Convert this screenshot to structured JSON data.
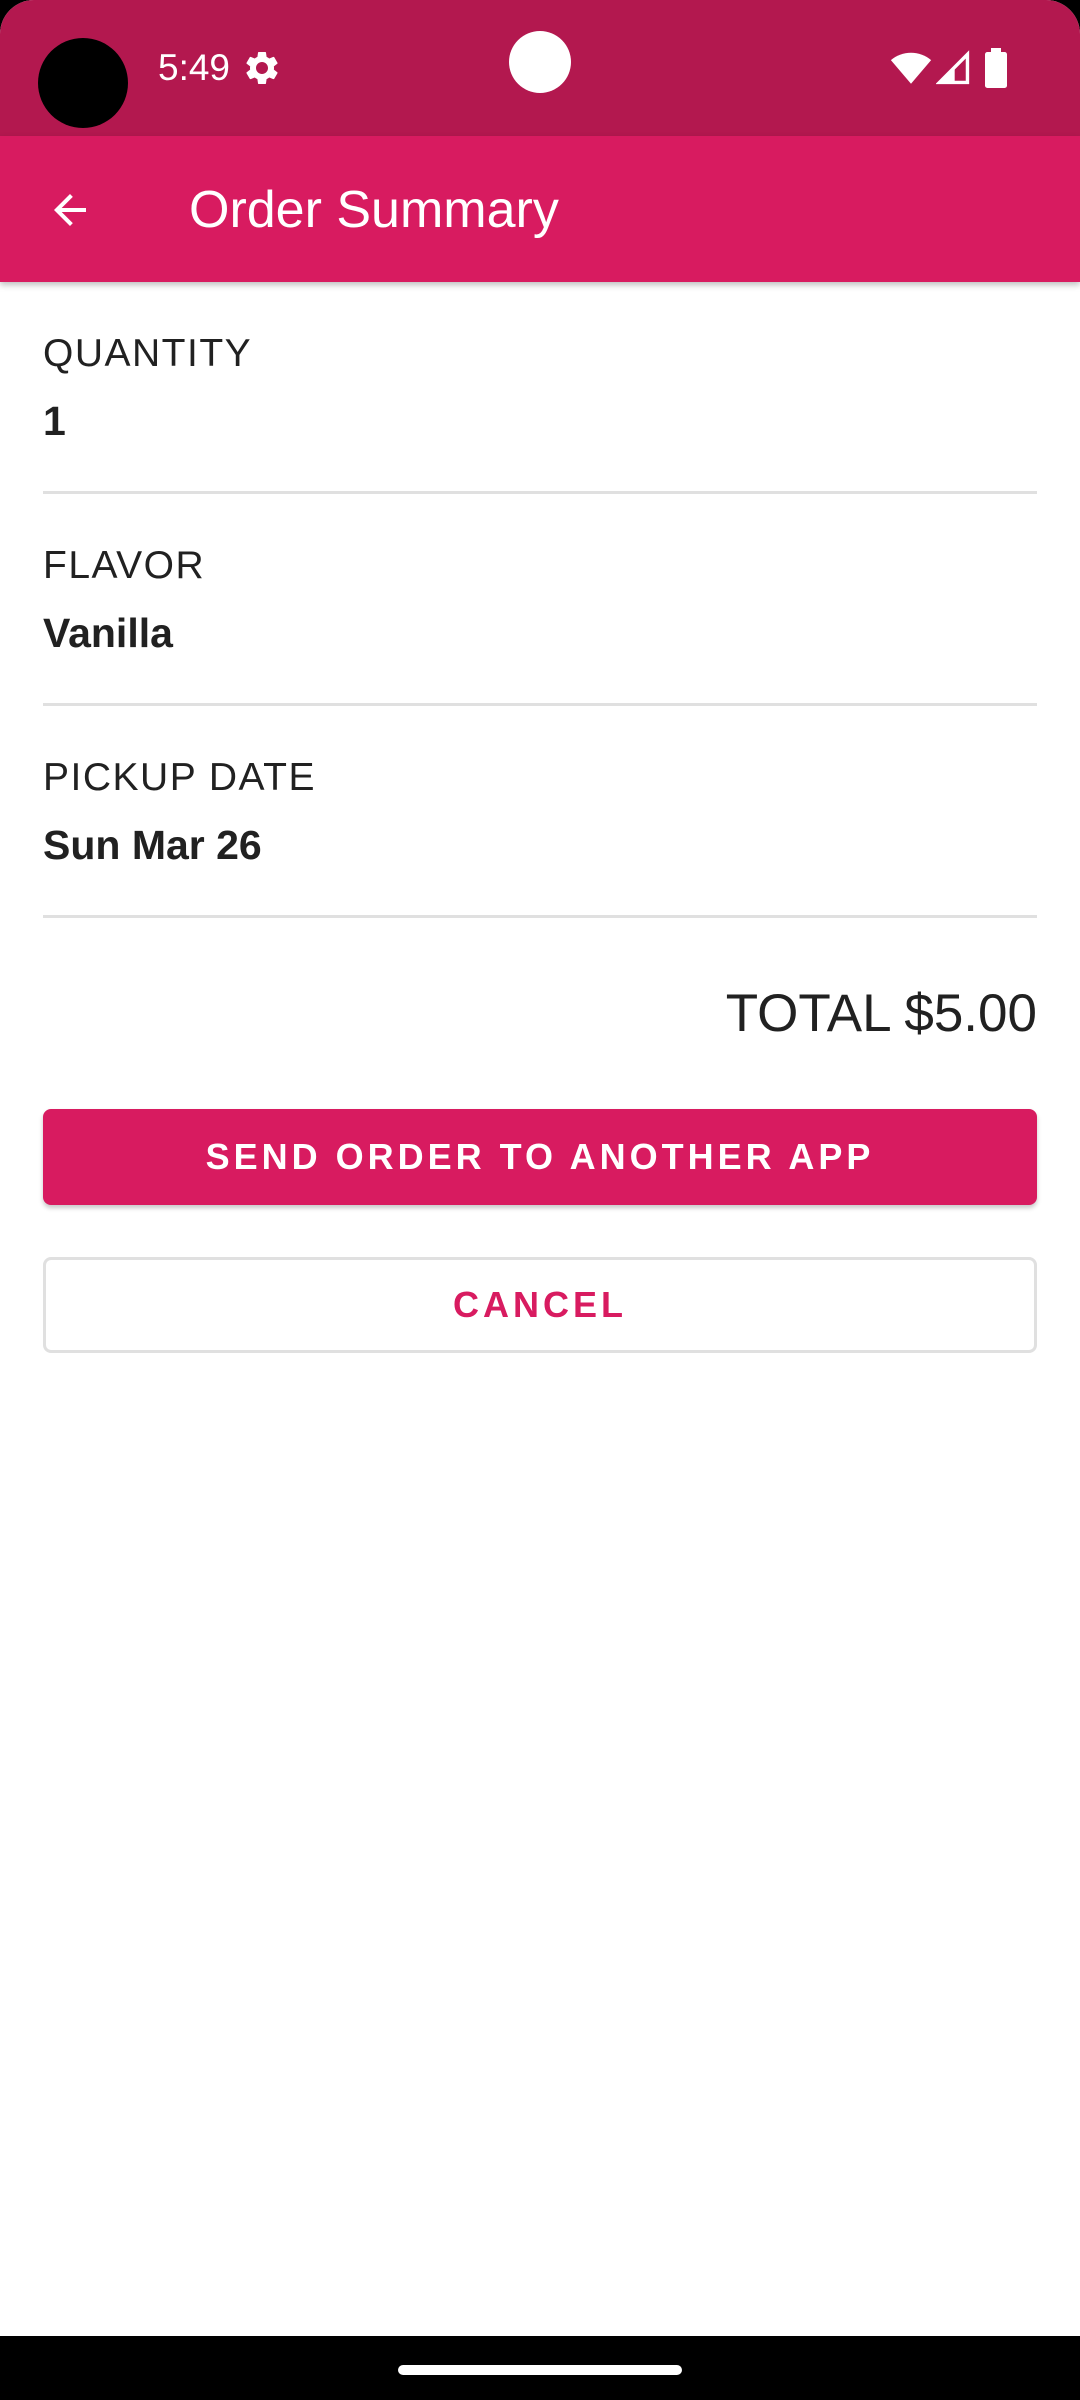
{
  "status_bar": {
    "time": "5:49",
    "icons": [
      "settings-gear-icon",
      "wifi-icon",
      "signal-icon",
      "battery-icon"
    ],
    "color": "#b3184f"
  },
  "app_bar": {
    "title": "Order Summary",
    "back_icon": "arrow-back-icon",
    "color": "#d81b60"
  },
  "summary": {
    "fields": [
      {
        "label": "QUANTITY",
        "value": "1"
      },
      {
        "label": "FLAVOR",
        "value": "Vanilla"
      },
      {
        "label": "PICKUP DATE",
        "value": "Sun Mar 26"
      }
    ],
    "total": "TOTAL $5.00"
  },
  "actions": {
    "send_label": "SEND ORDER TO ANOTHER APP",
    "cancel_label": "CANCEL"
  },
  "colors": {
    "accent": "#d81b60",
    "status_bar": "#b3184f",
    "text": "#212121",
    "divider": "#e0e0e0"
  }
}
